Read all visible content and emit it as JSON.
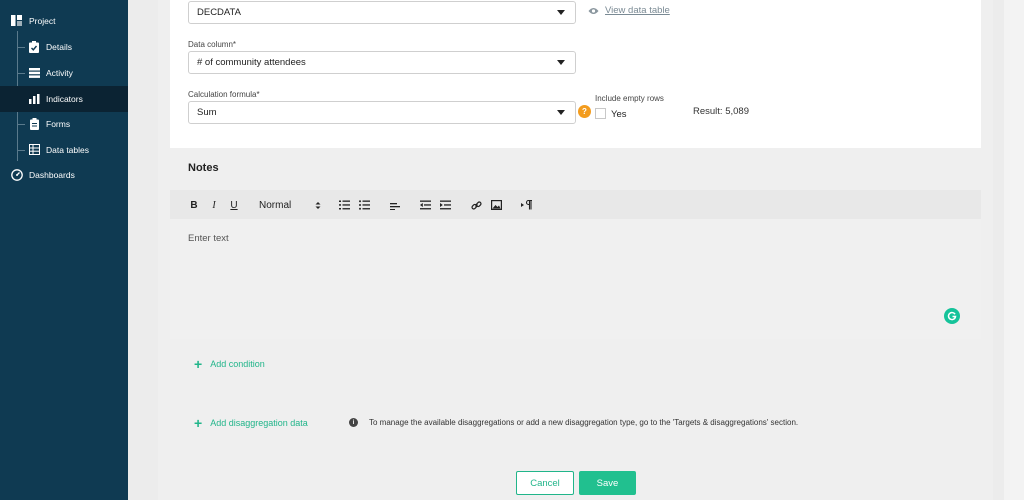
{
  "sidebar": {
    "project_label": "Project",
    "items": [
      {
        "label": "Details",
        "icon": "clipboard-check-icon"
      },
      {
        "label": "Activity",
        "icon": "server-icon"
      },
      {
        "label": "Indicators",
        "icon": "bar-chart-icon",
        "active": true
      },
      {
        "label": "Forms",
        "icon": "form-icon"
      },
      {
        "label": "Data tables",
        "icon": "table-icon"
      }
    ],
    "dashboards_label": "Dashboards"
  },
  "form": {
    "data_table_value": "DECDATA",
    "view_link": "View data table",
    "data_column_label": "Data column*",
    "data_column_value": "# of community attendees",
    "calc_label": "Calculation formula*",
    "calc_value": "Sum",
    "help_badge": "?",
    "include_empty_label": "Include empty rows",
    "include_empty_option": "Yes",
    "result": "Result: 5,089"
  },
  "notes": {
    "title": "Notes",
    "toolbar": {
      "bold": "B",
      "italic": "I",
      "underline": "U",
      "heading_select": "Normal"
    },
    "placeholder": "Enter text"
  },
  "actions": {
    "add_condition": "Add condition",
    "add_disaggregation": "Add disaggregation data",
    "info_text": "To manage the available disaggregations or add a new disaggregation type, go to the 'Targets & disaggregations' section.",
    "cancel": "Cancel",
    "save": "Save"
  },
  "colors": {
    "sidebar_bg": "#0f3a52",
    "sidebar_active": "#0b2333",
    "accent_green": "#21c08f",
    "help_orange": "#f39c1e"
  }
}
